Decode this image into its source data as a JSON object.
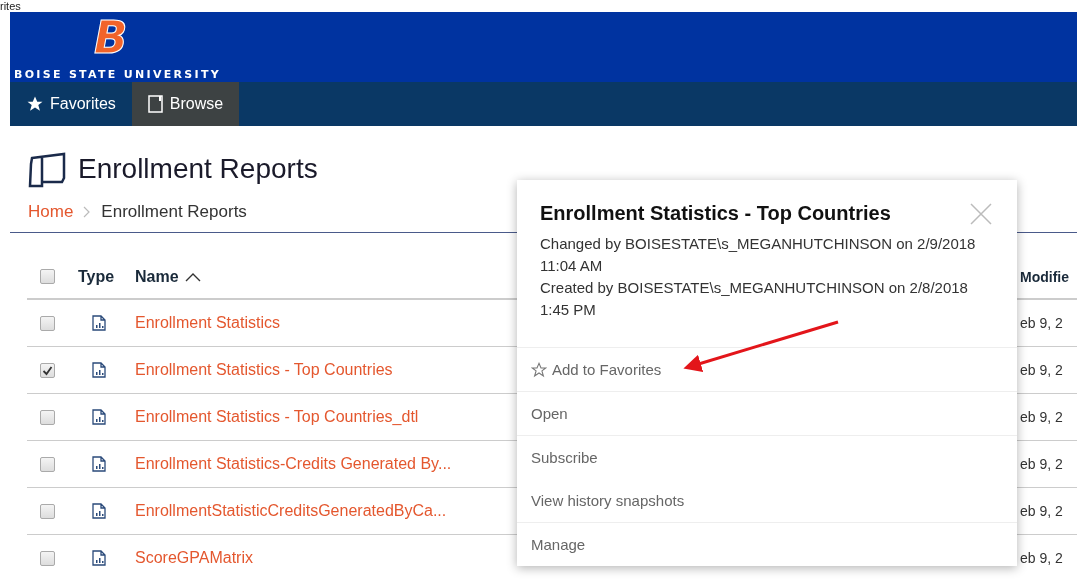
{
  "top_cut_text": "rites",
  "header": {
    "logo_letter": "B",
    "university": "BOISE STATE UNIVERSITY"
  },
  "nav": [
    {
      "label": "Favorites",
      "kind": "favorites",
      "selected": false
    },
    {
      "label": "Browse",
      "kind": "browse",
      "selected": true
    }
  ],
  "page": {
    "title": "Enrollment Reports",
    "breadcrumb": [
      "Home",
      "Enrollment Reports"
    ]
  },
  "table": {
    "columns": [
      "Type",
      "Name",
      "Modifie"
    ],
    "all_checked": false,
    "rows": [
      {
        "name": "Enrollment Statistics",
        "checked": false,
        "modified": "eb 9, 2"
      },
      {
        "name": "Enrollment Statistics - Top Countries",
        "checked": true,
        "modified": "eb 9, 2"
      },
      {
        "name": "Enrollment Statistics - Top Countries_dtl",
        "checked": false,
        "modified": "eb 9, 2"
      },
      {
        "name": "Enrollment Statistics-Credits Generated By...",
        "checked": false,
        "modified": "eb 9, 2"
      },
      {
        "name": "EnrollmentStatisticCreditsGeneratedByCa...",
        "checked": false,
        "modified": "eb 9, 2"
      },
      {
        "name": "ScoreGPAMatrix",
        "checked": false,
        "modified": "eb 9, 2"
      }
    ]
  },
  "popup": {
    "title": "Enrollment Statistics - Top Countries",
    "details": [
      "Changed by BOISESTATE\\s_MEGANHUTCHINSON on 2/9/2018 11:04 AM",
      "Created by BOISESTATE\\s_MEGANHUTCHINSON on 2/8/2018 1:45 PM"
    ],
    "menu_groups": [
      [
        {
          "label": "Add to Favorites",
          "kind": "favorite"
        }
      ],
      [
        {
          "label": "Open",
          "kind": "action"
        }
      ],
      [
        {
          "label": "Subscribe",
          "kind": "action"
        },
        {
          "label": "View history snapshots",
          "kind": "action"
        }
      ],
      [
        {
          "label": "Manage",
          "kind": "action"
        }
      ]
    ]
  }
}
